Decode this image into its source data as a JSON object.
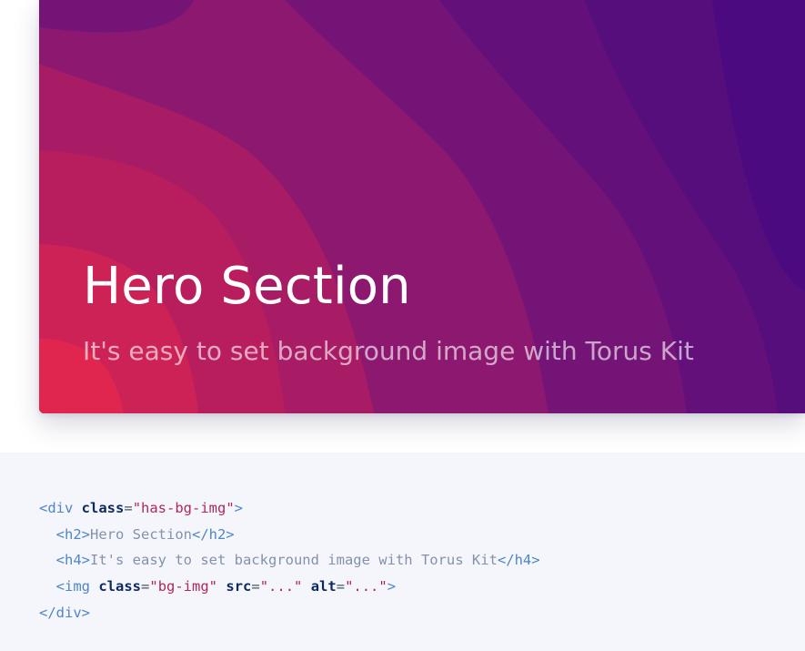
{
  "hero": {
    "title": "Hero Section",
    "subtitle": "It's easy to set background image with Torus Kit",
    "colors": {
      "gradient_start": "#e8294b",
      "gradient_mid": "#8c1a6e",
      "gradient_end": "#4a0c82"
    }
  },
  "code": {
    "line1": {
      "open": "<div",
      "attr1": "class",
      "eq": "=",
      "val1": "\"has-bg-img\"",
      "close": ">"
    },
    "line2": {
      "indent": "  ",
      "open": "<h2>",
      "text": "Hero Section",
      "close": "</h2>"
    },
    "line3": {
      "indent": "  ",
      "open": "<h4>",
      "text": "It's easy to set background image with Torus Kit",
      "close": "</h4>"
    },
    "line4": {
      "indent": "  ",
      "open": "<img",
      "attr1": "class",
      "val1": "\"bg-img\"",
      "attr2": "src",
      "val2": "\"...\"",
      "attr3": "alt",
      "val3": "\"...\"",
      "eq": "=",
      "close": ">"
    },
    "line5": {
      "close": "</div>"
    }
  }
}
